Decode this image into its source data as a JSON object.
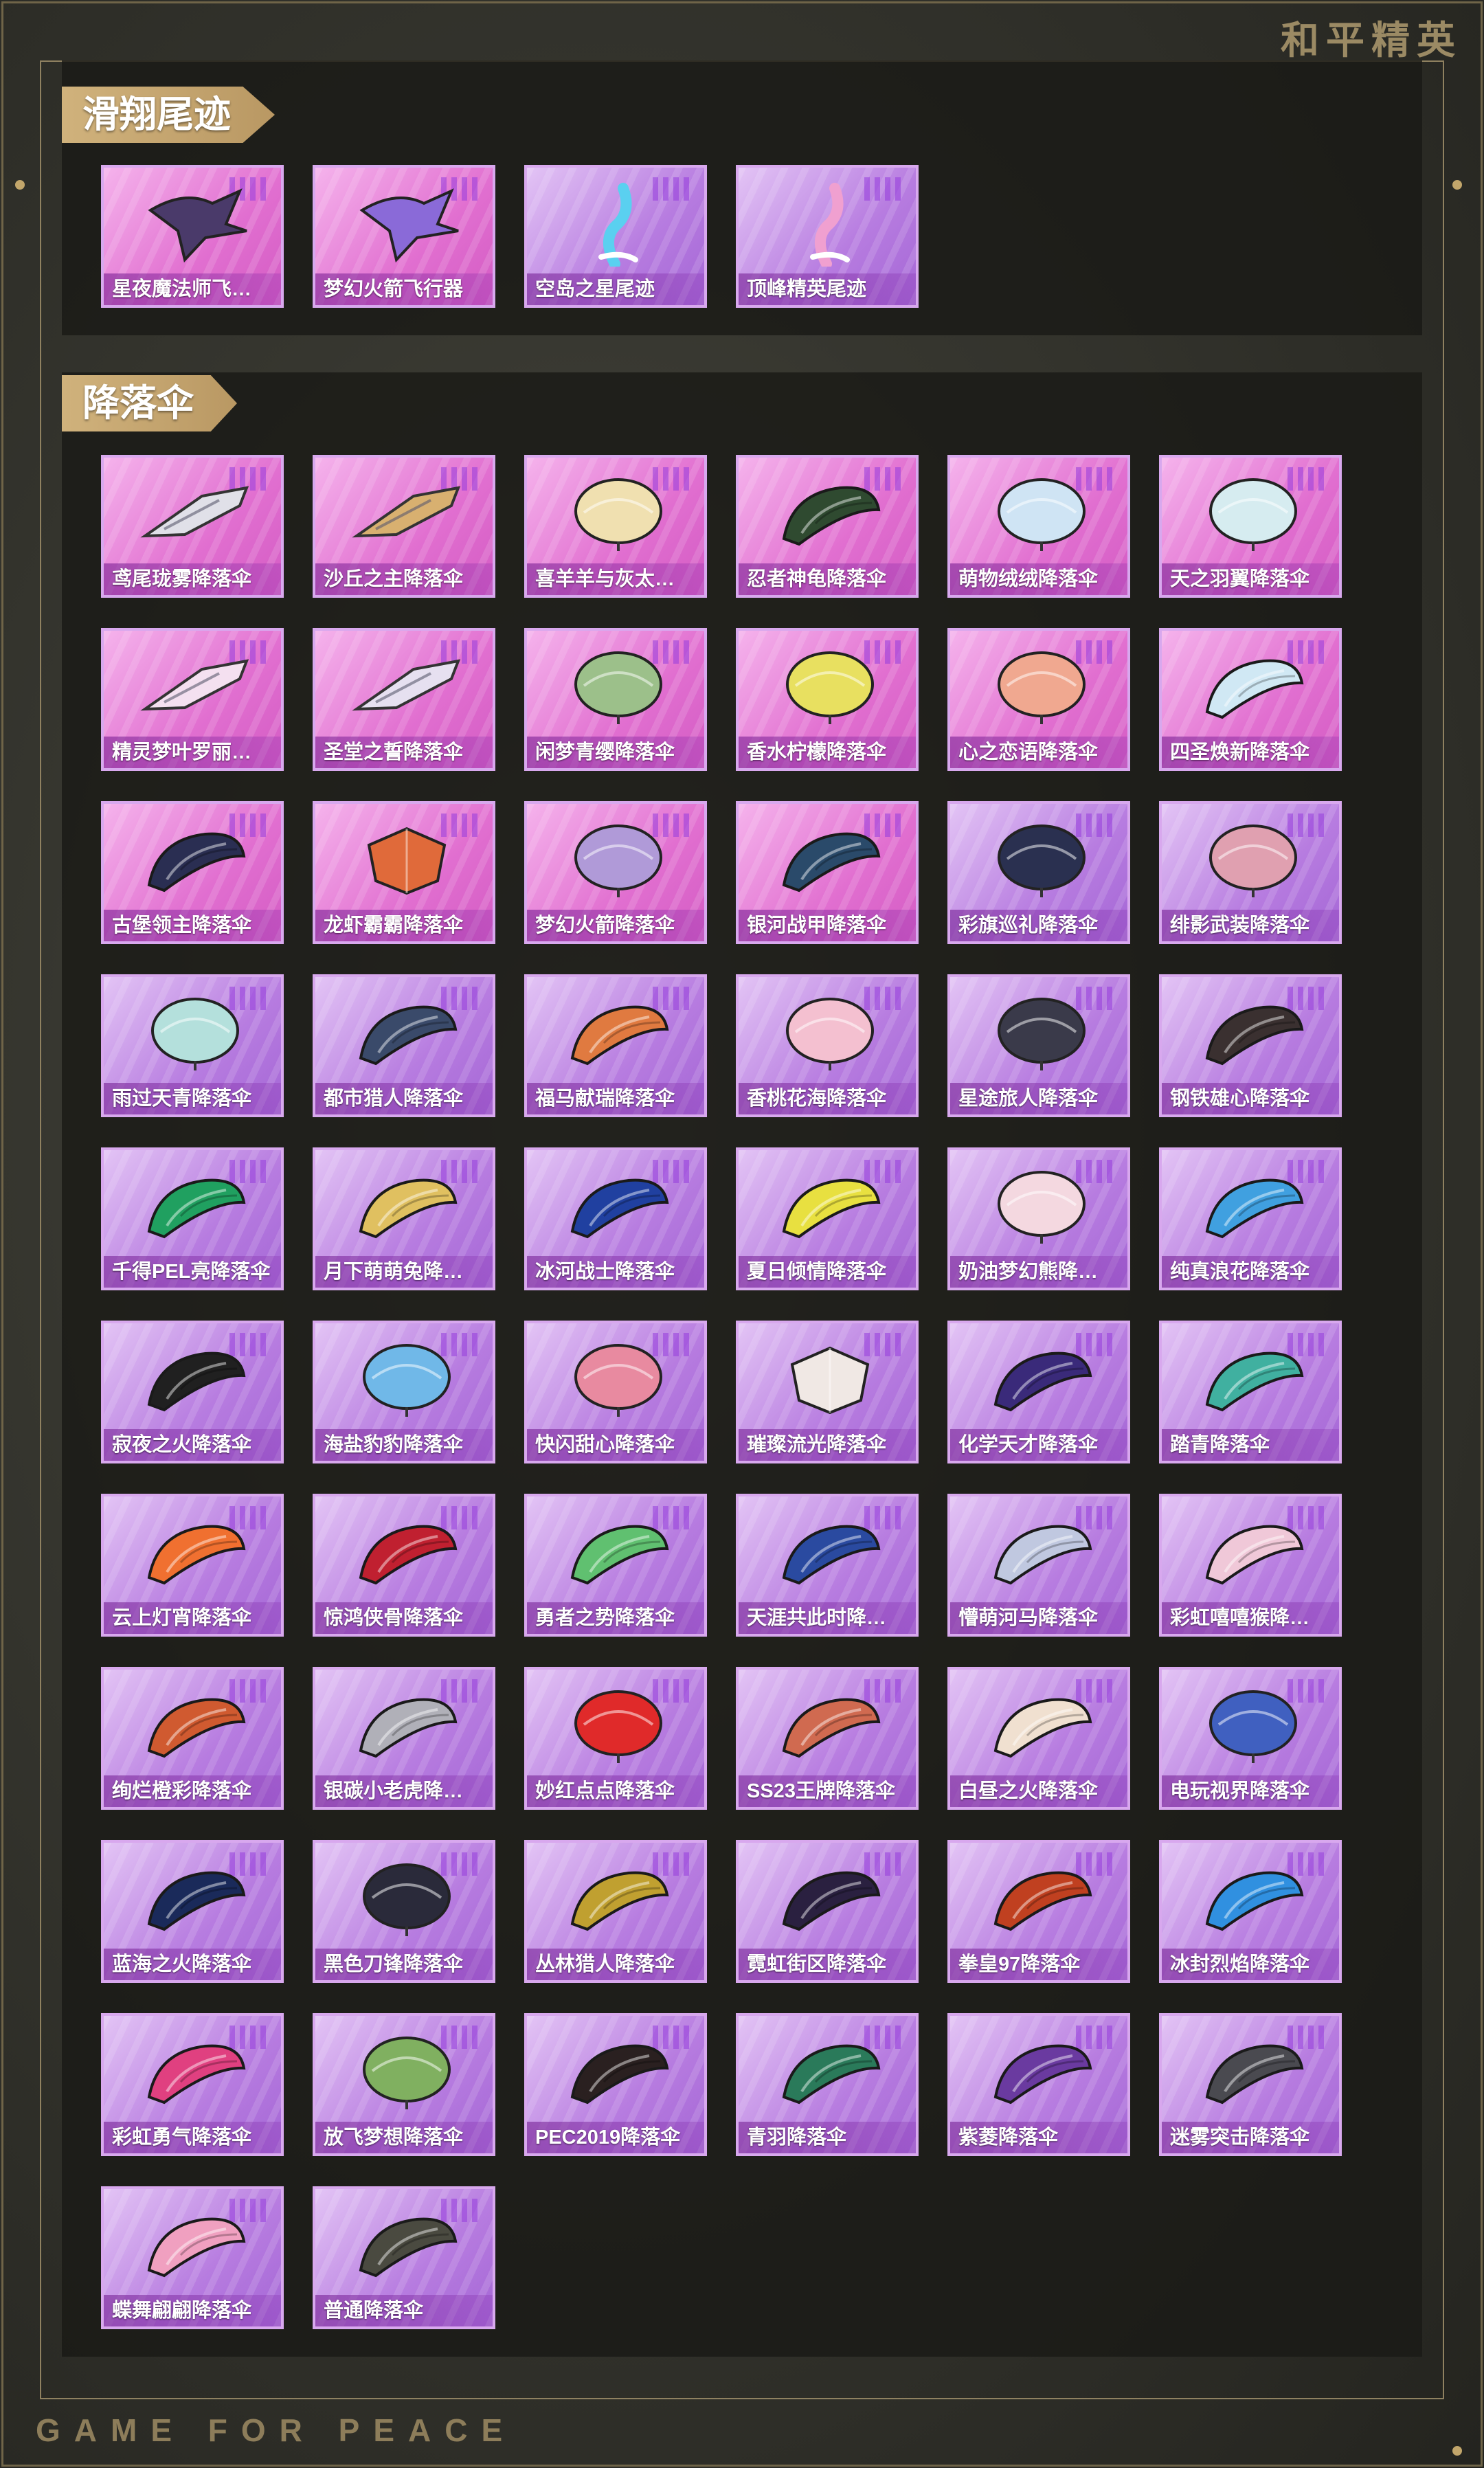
{
  "header": {
    "brand_cn": "和平精英"
  },
  "footer": {
    "brand_en": "GAME FOR PEACE"
  },
  "sections": {
    "gliders": {
      "title": "滑翔尾迹",
      "items": [
        {
          "label": "星夜魔法师飞…",
          "icon": "wing-glider-icon",
          "tone": "pink",
          "color": "#4a3a6a"
        },
        {
          "label": "梦幻火箭飞行器",
          "icon": "wing-glider-icon",
          "tone": "pink",
          "color": "#8a6ad8"
        },
        {
          "label": "空岛之星尾迹",
          "icon": "trail-icon",
          "tone": "violet",
          "color": "#5ad0f0"
        },
        {
          "label": "顶峰精英尾迹",
          "icon": "trail-icon",
          "tone": "violet",
          "color": "#f0a0d0"
        }
      ]
    },
    "parachutes": {
      "title": "降落伞",
      "items": [
        {
          "label": "鸢尾珑雾降落伞",
          "icon": "glider-shape-icon",
          "tone": "pink",
          "color": "#e0e0e8"
        },
        {
          "label": "沙丘之主降落伞",
          "icon": "glider-shape-icon",
          "tone": "pink",
          "color": "#d8b070"
        },
        {
          "label": "喜羊羊与灰太…",
          "icon": "round-parachute-icon",
          "tone": "pink",
          "color": "#f0e0b0"
        },
        {
          "label": "忍者神龟降落伞",
          "icon": "wing-parachute-icon",
          "tone": "pink",
          "color": "#2f4a30"
        },
        {
          "label": "萌物绒绒降落伞",
          "icon": "round-parachute-icon",
          "tone": "pink",
          "color": "#cfe4f4"
        },
        {
          "label": "天之羽翼降落伞",
          "icon": "round-parachute-icon",
          "tone": "pink",
          "color": "#d6ecf0"
        },
        {
          "label": "精灵梦叶罗丽…",
          "icon": "glider-shape-icon",
          "tone": "pink",
          "color": "#f4e0f0"
        },
        {
          "label": "圣堂之誓降落伞",
          "icon": "glider-shape-icon",
          "tone": "pink",
          "color": "#e6e0f0"
        },
        {
          "label": "闲梦青缨降落伞",
          "icon": "round-parachute-icon",
          "tone": "pink",
          "color": "#9cc08a"
        },
        {
          "label": "香水柠檬降落伞",
          "icon": "round-parachute-icon",
          "tone": "pink",
          "color": "#e8e060"
        },
        {
          "label": "心之恋语降落伞",
          "icon": "round-parachute-icon",
          "tone": "pink",
          "color": "#f0a890"
        },
        {
          "label": "四圣焕新降落伞",
          "icon": "wing-parachute-icon",
          "tone": "pink",
          "color": "#d0e8f4"
        },
        {
          "label": "古堡领主降落伞",
          "icon": "wing-parachute-icon",
          "tone": "pink",
          "color": "#2a2e52"
        },
        {
          "label": "龙虾霸霸降落伞",
          "icon": "square-parachute-icon",
          "tone": "pink",
          "color": "#e06a3a"
        },
        {
          "label": "梦幻火箭降落伞",
          "icon": "round-parachute-icon",
          "tone": "pink",
          "color": "#b09ad8"
        },
        {
          "label": "银河战甲降落伞",
          "icon": "wing-parachute-icon",
          "tone": "pink",
          "color": "#2a4a6a"
        },
        {
          "label": "彩旗巡礼降落伞",
          "icon": "round-parachute-icon",
          "tone": "violet",
          "color": "#2a3050"
        },
        {
          "label": "绯影武装降落伞",
          "icon": "round-parachute-icon",
          "tone": "violet",
          "color": "#e0a0b0"
        },
        {
          "label": "雨过天青降落伞",
          "icon": "round-parachute-icon",
          "tone": "violet",
          "color": "#b4e0dc"
        },
        {
          "label": "都市猎人降落伞",
          "icon": "wing-parachute-icon",
          "tone": "violet",
          "color": "#3a4a6a"
        },
        {
          "label": "福马献瑞降落伞",
          "icon": "wing-parachute-icon",
          "tone": "violet",
          "color": "#e07a40"
        },
        {
          "label": "香桃花海降落伞",
          "icon": "round-parachute-icon",
          "tone": "violet",
          "color": "#f4c0d0"
        },
        {
          "label": "星途旅人降落伞",
          "icon": "round-parachute-icon",
          "tone": "violet",
          "color": "#3a3a4a"
        },
        {
          "label": "钢铁雄心降落伞",
          "icon": "wing-parachute-icon",
          "tone": "violet",
          "color": "#3a3030"
        },
        {
          "label": "千得PEL亮降落伞",
          "icon": "wing-parachute-icon",
          "tone": "violet",
          "color": "#20a060"
        },
        {
          "label": "月下萌萌兔降…",
          "icon": "wing-parachute-icon",
          "tone": "violet",
          "color": "#e0c060"
        },
        {
          "label": "冰河战士降落伞",
          "icon": "wing-parachute-icon",
          "tone": "violet",
          "color": "#2040a0"
        },
        {
          "label": "夏日倾情降落伞",
          "icon": "wing-parachute-icon",
          "tone": "violet",
          "color": "#e8e040"
        },
        {
          "label": "奶油梦幻熊降…",
          "icon": "round-parachute-icon",
          "tone": "violet",
          "color": "#f4d8e0"
        },
        {
          "label": "纯真浪花降落伞",
          "icon": "wing-parachute-icon",
          "tone": "violet",
          "color": "#40a0e0"
        },
        {
          "label": "寂夜之火降落伞",
          "icon": "wing-parachute-icon",
          "tone": "violet",
          "color": "#202020"
        },
        {
          "label": "海盐豹豹降落伞",
          "icon": "round-parachute-icon",
          "tone": "violet",
          "color": "#70b8e8"
        },
        {
          "label": "快闪甜心降落伞",
          "icon": "round-parachute-icon",
          "tone": "violet",
          "color": "#e88aa0"
        },
        {
          "label": "璀璨流光降落伞",
          "icon": "square-parachute-icon",
          "tone": "violet",
          "color": "#f0e8e4"
        },
        {
          "label": "化学天才降落伞",
          "icon": "wing-parachute-icon",
          "tone": "violet",
          "color": "#3a2a7a"
        },
        {
          "label": "踏青降落伞",
          "icon": "wing-parachute-icon",
          "tone": "violet",
          "color": "#40b0a0"
        },
        {
          "label": "云上灯宵降落伞",
          "icon": "wing-parachute-icon",
          "tone": "violet",
          "color": "#f07030"
        },
        {
          "label": "惊鸿侠骨降落伞",
          "icon": "wing-parachute-icon",
          "tone": "violet",
          "color": "#c02030"
        },
        {
          "label": "勇者之势降落伞",
          "icon": "wing-parachute-icon",
          "tone": "violet",
          "color": "#60c070"
        },
        {
          "label": "天涯共此时降…",
          "icon": "wing-parachute-icon",
          "tone": "violet",
          "color": "#2a4aa0"
        },
        {
          "label": "懵萌河马降落伞",
          "icon": "wing-parachute-icon",
          "tone": "violet",
          "color": "#c0c8e0"
        },
        {
          "label": "彩虹嘻嘻猴降…",
          "icon": "wing-parachute-icon",
          "tone": "violet",
          "color": "#f0c8d8"
        },
        {
          "label": "绚烂橙彩降落伞",
          "icon": "wing-parachute-icon",
          "tone": "violet",
          "color": "#d05a30"
        },
        {
          "label": "银碳小老虎降…",
          "icon": "wing-parachute-icon",
          "tone": "violet",
          "color": "#b0b0b8"
        },
        {
          "label": "妙红点点降落伞",
          "icon": "round-parachute-icon",
          "tone": "violet",
          "color": "#e02a2a"
        },
        {
          "label": "SS23王牌降落伞",
          "icon": "wing-parachute-icon",
          "tone": "violet",
          "color": "#d06a50"
        },
        {
          "label": "白昼之火降落伞",
          "icon": "wing-parachute-icon",
          "tone": "violet",
          "color": "#f0e0d0"
        },
        {
          "label": "电玩视界降落伞",
          "icon": "round-parachute-icon",
          "tone": "violet",
          "color": "#4060c0"
        },
        {
          "label": "蓝海之火降落伞",
          "icon": "wing-parachute-icon",
          "tone": "violet",
          "color": "#1a2a5a"
        },
        {
          "label": "黑色刀锋降落伞",
          "icon": "round-parachute-icon",
          "tone": "violet",
          "color": "#2a2a3a"
        },
        {
          "label": "丛林猎人降落伞",
          "icon": "wing-parachute-icon",
          "tone": "violet",
          "color": "#c0a030"
        },
        {
          "label": "霓虹街区降落伞",
          "icon": "wing-parachute-icon",
          "tone": "violet",
          "color": "#2a2040"
        },
        {
          "label": "拳皇97降落伞",
          "icon": "wing-parachute-icon",
          "tone": "violet",
          "color": "#c04020"
        },
        {
          "label": "冰封烈焰降落伞",
          "icon": "wing-parachute-icon",
          "tone": "violet",
          "color": "#3090e0"
        },
        {
          "label": "彩虹勇气降落伞",
          "icon": "wing-parachute-icon",
          "tone": "violet",
          "color": "#e04080"
        },
        {
          "label": "放飞梦想降落伞",
          "icon": "round-parachute-icon",
          "tone": "violet",
          "color": "#80b060"
        },
        {
          "label": "PEC2019降落伞",
          "icon": "wing-parachute-icon",
          "tone": "violet",
          "color": "#2a2020"
        },
        {
          "label": "青羽降落伞",
          "icon": "wing-parachute-icon",
          "tone": "violet",
          "color": "#2a7a5a"
        },
        {
          "label": "紫菱降落伞",
          "icon": "wing-parachute-icon",
          "tone": "violet",
          "color": "#6a3aa0"
        },
        {
          "label": "迷雾突击降落伞",
          "icon": "wing-parachute-icon",
          "tone": "violet",
          "color": "#4a4a50"
        },
        {
          "label": "蝶舞翩翩降落伞",
          "icon": "wing-parachute-icon",
          "tone": "violet",
          "color": "#f0a0c0"
        },
        {
          "label": "普通降落伞",
          "icon": "wing-parachute-icon",
          "tone": "violet",
          "color": "#4a4a40"
        }
      ]
    }
  }
}
